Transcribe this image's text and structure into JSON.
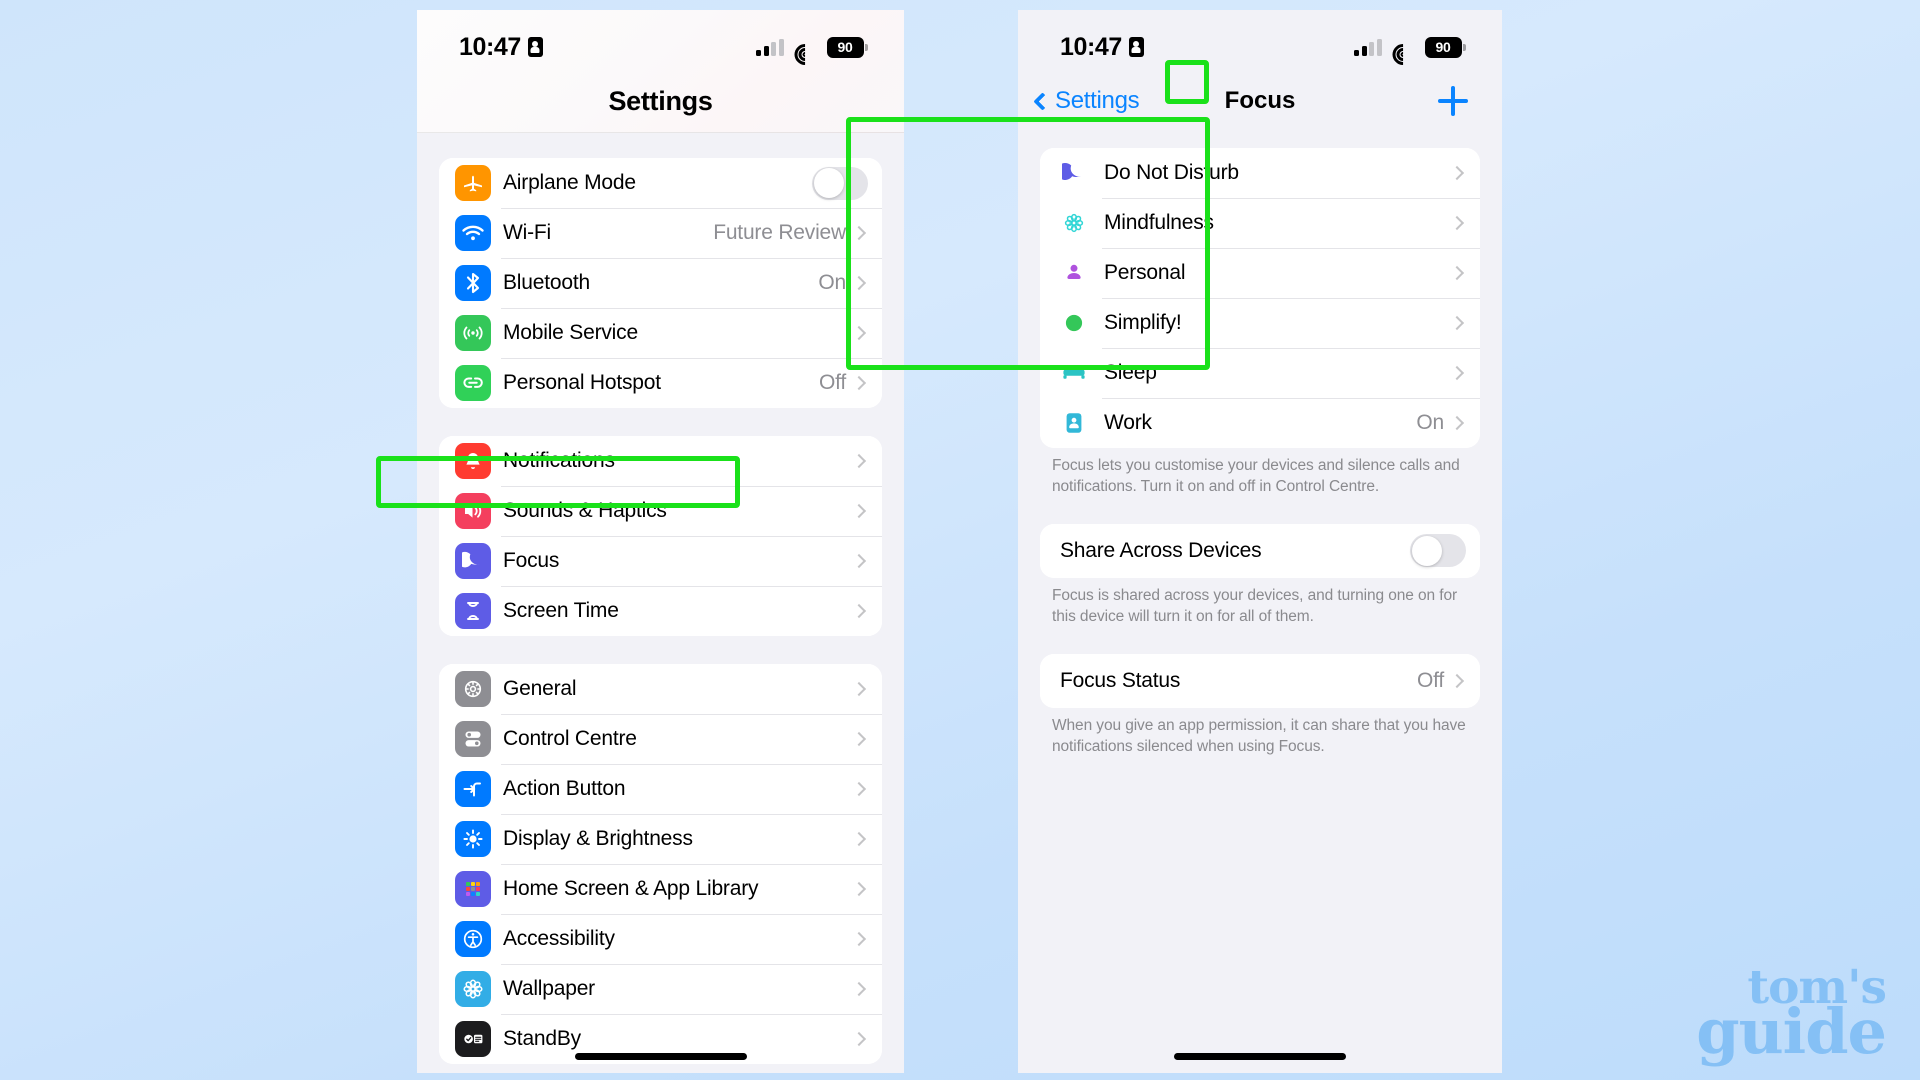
{
  "background": {
    "color_top": "#cfe5fb",
    "color_bottom": "#bddcfb"
  },
  "watermark": {
    "line1": "tom's",
    "line2": "guide",
    "color": "#85c0f5"
  },
  "highlight_color": "#1ae11a",
  "phones": {
    "left": {
      "status_bar": {
        "time": "10:47",
        "lock_icon": "lock-portrait-icon",
        "signal_icon": "cellular-signal-icon",
        "wifi_icon": "wifi-icon",
        "battery_level": "90"
      },
      "header": {
        "title": "Settings"
      },
      "groups": [
        {
          "rows": [
            {
              "label": "Airplane Mode",
              "icon": "airplane-icon",
              "icon_color": "#ff9500",
              "accessory": "toggle",
              "toggle_on": false
            },
            {
              "label": "Wi-Fi",
              "icon": "wifi-icon",
              "icon_color": "#007aff",
              "value": "Future Review",
              "accessory": "chevron"
            },
            {
              "label": "Bluetooth",
              "icon": "bluetooth-icon",
              "icon_color": "#007aff",
              "value": "On",
              "accessory": "chevron"
            },
            {
              "label": "Mobile Service",
              "icon": "antenna-icon",
              "icon_color": "#34c759",
              "value": "",
              "accessory": "chevron"
            },
            {
              "label": "Personal Hotspot",
              "icon": "hotspot-link-icon",
              "icon_color": "#30d158",
              "value": "Off",
              "accessory": "chevron"
            }
          ]
        },
        {
          "rows": [
            {
              "label": "Notifications",
              "icon": "bell-icon",
              "icon_color": "#ff3b30",
              "value": "",
              "accessory": "chevron"
            },
            {
              "label": "Sounds & Haptics",
              "icon": "speaker-icon",
              "icon_color": "#f43f5e",
              "value": "",
              "accessory": "chevron"
            },
            {
              "label": "Focus",
              "icon": "moon-icon",
              "icon_color": "#5e5ce6",
              "value": "",
              "accessory": "chevron",
              "highlighted": true
            },
            {
              "label": "Screen Time",
              "icon": "hourglass-icon",
              "icon_color": "#5e5ce6",
              "value": "",
              "accessory": "chevron"
            }
          ]
        },
        {
          "rows": [
            {
              "label": "General",
              "icon": "gear-icon",
              "icon_color": "#8e8e93",
              "value": "",
              "accessory": "chevron"
            },
            {
              "label": "Control Centre",
              "icon": "control-centre-icon",
              "icon_color": "#8e8e93",
              "value": "",
              "accessory": "chevron"
            },
            {
              "label": "Action Button",
              "icon": "action-button-icon",
              "icon_color": "#007aff",
              "value": "",
              "accessory": "chevron"
            },
            {
              "label": "Display & Brightness",
              "icon": "brightness-icon",
              "icon_color": "#007aff",
              "value": "",
              "accessory": "chevron"
            },
            {
              "label": "Home Screen & App Library",
              "icon": "app-grid-icon",
              "icon_color": "#5e5ce6",
              "value": "",
              "accessory": "chevron"
            },
            {
              "label": "Accessibility",
              "icon": "accessibility-icon",
              "icon_color": "#007aff",
              "value": "",
              "accessory": "chevron"
            },
            {
              "label": "Wallpaper",
              "icon": "flower-icon",
              "icon_color": "#32ade6",
              "value": "",
              "accessory": "chevron"
            },
            {
              "label": "StandBy",
              "icon": "standby-clock-icon",
              "icon_color": "#1c1c1e",
              "value": "",
              "accessory": "chevron"
            }
          ]
        }
      ]
    },
    "right": {
      "status_bar": {
        "time": "10:47",
        "lock_icon": "lock-portrait-icon",
        "signal_icon": "cellular-signal-icon",
        "wifi_icon": "wifi-icon",
        "battery_level": "90"
      },
      "nav": {
        "back_label": "Settings",
        "title": "Focus",
        "add_button": "plus-icon"
      },
      "focus_list": [
        {
          "label": "Do Not Disturb",
          "icon": "moon-icon",
          "icon_color": "#5e5ce6",
          "value": "",
          "accessory": "chevron"
        },
        {
          "label": "Mindfulness",
          "icon": "mindfulness-flower-icon",
          "icon_color": "#32d6d6",
          "value": "",
          "accessory": "chevron"
        },
        {
          "label": "Personal",
          "icon": "person-icon",
          "icon_color": "#af52de",
          "value": "",
          "accessory": "chevron"
        },
        {
          "label": "Simplify!",
          "icon": "green-circle-icon",
          "icon_color": "#34c759",
          "value": "",
          "accessory": "chevron"
        },
        {
          "label": "Sleep",
          "icon": "bed-icon",
          "icon_color": "#2bc4c4",
          "value": "",
          "accessory": "chevron"
        },
        {
          "label": "Work",
          "icon": "work-badge-icon",
          "icon_color": "#32b8d8",
          "value": "On",
          "accessory": "chevron"
        }
      ],
      "focus_footnote": "Focus lets you customise your devices and silence calls and notifications. Turn it on and off in Control Centre.",
      "share_row": {
        "label": "Share Across Devices",
        "toggle_on": false
      },
      "share_footnote": "Focus is shared across your devices, and turning one on for this device will turn it on for all of them.",
      "status_row": {
        "label": "Focus Status",
        "value": "Off"
      },
      "status_footnote": "When you give an app permission, it can share that you have notifications silenced when using Focus."
    }
  }
}
